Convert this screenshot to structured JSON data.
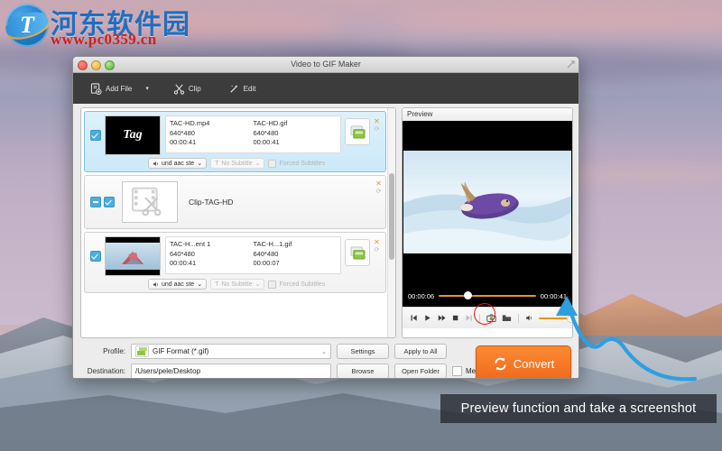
{
  "watermark": {
    "cn_text": "河东软件园",
    "url": "www.pc0359.cn",
    "mark": "T"
  },
  "window": {
    "title": "Video to GIF Maker",
    "traffic": {
      "close": "close-button",
      "minimize": "minimize-button",
      "zoom": "zoom-button"
    }
  },
  "toolbar": {
    "add_file": "Add File",
    "add_file_caret": "▾",
    "clip": "Clip",
    "edit": "Edit"
  },
  "file_list": {
    "rows": [
      {
        "selected": true,
        "checked": true,
        "thumb_label": "Tag",
        "source": {
          "name": "TAC-HD.mp4",
          "resolution": "640*480",
          "duration": "00:00:41"
        },
        "output": {
          "name": "TAC-HD.gif",
          "resolution": "640*480",
          "duration": "00:00:41"
        },
        "audio_track": "und aac ste",
        "subtitle": "No Subtitle",
        "forced_subtitles": "Forced Subtitles",
        "remove": "✕",
        "reload": "⟳"
      },
      {
        "type": "clip",
        "name": "Clip-TAG-HD",
        "remove": "✕",
        "reload": "⟳"
      },
      {
        "selected": false,
        "checked": true,
        "source": {
          "name": "TAC-H...ent 1",
          "resolution": "640*480",
          "duration": "00:00:41"
        },
        "output": {
          "name": "TAC-H...1.gif",
          "resolution": "640*480",
          "duration": "00:00:07"
        },
        "audio_track": "und aac ste",
        "subtitle": "No Subtitle",
        "forced_subtitles": "Forced Subtitles",
        "remove": "✕",
        "reload": "⟳"
      }
    ]
  },
  "preview": {
    "header": "Preview",
    "current_time": "00:00:06",
    "total_time": "00:00:41",
    "progress_percent": 26,
    "volume_percent": 100,
    "controls": [
      {
        "name": "previous-button",
        "glyph": "⏮",
        "enabled": true
      },
      {
        "name": "play-button",
        "glyph": "▶",
        "enabled": true
      },
      {
        "name": "fast-forward-button",
        "glyph": "⏩",
        "enabled": true
      },
      {
        "name": "stop-button",
        "glyph": "■",
        "enabled": true
      },
      {
        "name": "next-button",
        "glyph": "⏭",
        "enabled": false
      },
      {
        "name": "snapshot-button",
        "glyph": "📷",
        "enabled": true,
        "highlighted": true
      },
      {
        "name": "open-snapshot-folder-button",
        "glyph": "🗀",
        "enabled": true
      },
      {
        "name": "volume-button",
        "glyph": "🔊",
        "enabled": true
      }
    ]
  },
  "settings": {
    "profile_label": "Profile:",
    "profile_value": "GIF Format (*.gif)",
    "settings_button": "Settings",
    "apply_to_all_button": "Apply to All",
    "destination_label": "Destination:",
    "destination_value": "/Users/pele/Desktop",
    "browse_button": "Browse",
    "open_folder_button": "Open Folder",
    "merge_label": "Merge into one file",
    "merge_checked": false,
    "convert_button": "Convert"
  },
  "annotation": {
    "caption": "Preview function  and take a screenshot",
    "arrow_color": "#2e9fe0",
    "highlight_color": "#e01a1a"
  },
  "colors": {
    "accent_orange": "#f1691b",
    "toolbar_dark": "#3c3c3c",
    "selection_blue": "#cbe9f8",
    "seek_orange": "#e8951f"
  }
}
